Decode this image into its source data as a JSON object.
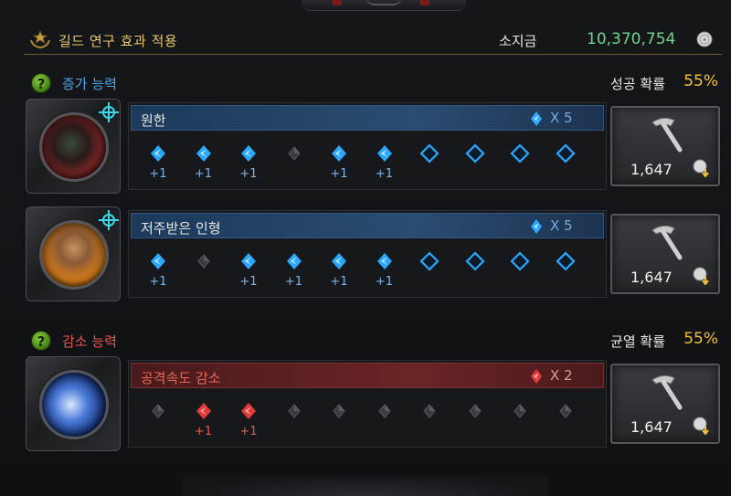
{
  "header": {
    "title": "길드 연구 효과 적용",
    "gold_label": "소지금",
    "gold_value": "10,370,754",
    "emblem_icon": "guild-laurel-icon",
    "coin_icon": "silver-coin-icon"
  },
  "increase": {
    "label": "증가 능력",
    "label_color": "#4aa6e8",
    "rate_label": "성공 확률",
    "rate_value": "55%",
    "rows": [
      {
        "name": "원한",
        "multiplier": "X 5",
        "cost": "1,647",
        "slots": [
          {
            "state": "filled",
            "plus": "+1"
          },
          {
            "state": "filled",
            "plus": "+1"
          },
          {
            "state": "filled",
            "plus": "+1"
          },
          {
            "state": "failed",
            "plus": ""
          },
          {
            "state": "filled",
            "plus": "+1"
          },
          {
            "state": "filled",
            "plus": "+1"
          },
          {
            "state": "empty",
            "plus": ""
          },
          {
            "state": "empty",
            "plus": ""
          },
          {
            "state": "empty",
            "plus": ""
          },
          {
            "state": "empty",
            "plus": ""
          }
        ]
      },
      {
        "name": "저주받은 인형",
        "multiplier": "X 5",
        "cost": "1,647",
        "slots": [
          {
            "state": "filled",
            "plus": "+1"
          },
          {
            "state": "failed",
            "plus": ""
          },
          {
            "state": "filled",
            "plus": "+1"
          },
          {
            "state": "filled",
            "plus": "+1"
          },
          {
            "state": "filled",
            "plus": "+1"
          },
          {
            "state": "filled",
            "plus": "+1"
          },
          {
            "state": "empty",
            "plus": ""
          },
          {
            "state": "empty",
            "plus": ""
          },
          {
            "state": "empty",
            "plus": ""
          },
          {
            "state": "empty",
            "plus": ""
          }
        ]
      }
    ]
  },
  "decrease": {
    "label": "감소 능력",
    "label_color": "#e25a4a",
    "rate_label": "균열 확률",
    "rate_value": "55%",
    "rows": [
      {
        "name": "공격속도 감소",
        "multiplier": "X 2",
        "cost": "1,647",
        "slots": [
          {
            "state": "failed",
            "plus": ""
          },
          {
            "state": "filled",
            "plus": "+1"
          },
          {
            "state": "filled",
            "plus": "+1"
          },
          {
            "state": "failed",
            "plus": ""
          },
          {
            "state": "failed",
            "plus": ""
          },
          {
            "state": "failed",
            "plus": ""
          },
          {
            "state": "failed",
            "plus": ""
          },
          {
            "state": "failed",
            "plus": ""
          },
          {
            "state": "failed",
            "plus": ""
          },
          {
            "state": "failed",
            "plus": ""
          }
        ]
      }
    ]
  },
  "colors": {
    "blue_gem": "#2aa8ff",
    "red_gem": "#e23a3a",
    "gold": "#f0c23a",
    "green_value": "#6fd78a"
  }
}
